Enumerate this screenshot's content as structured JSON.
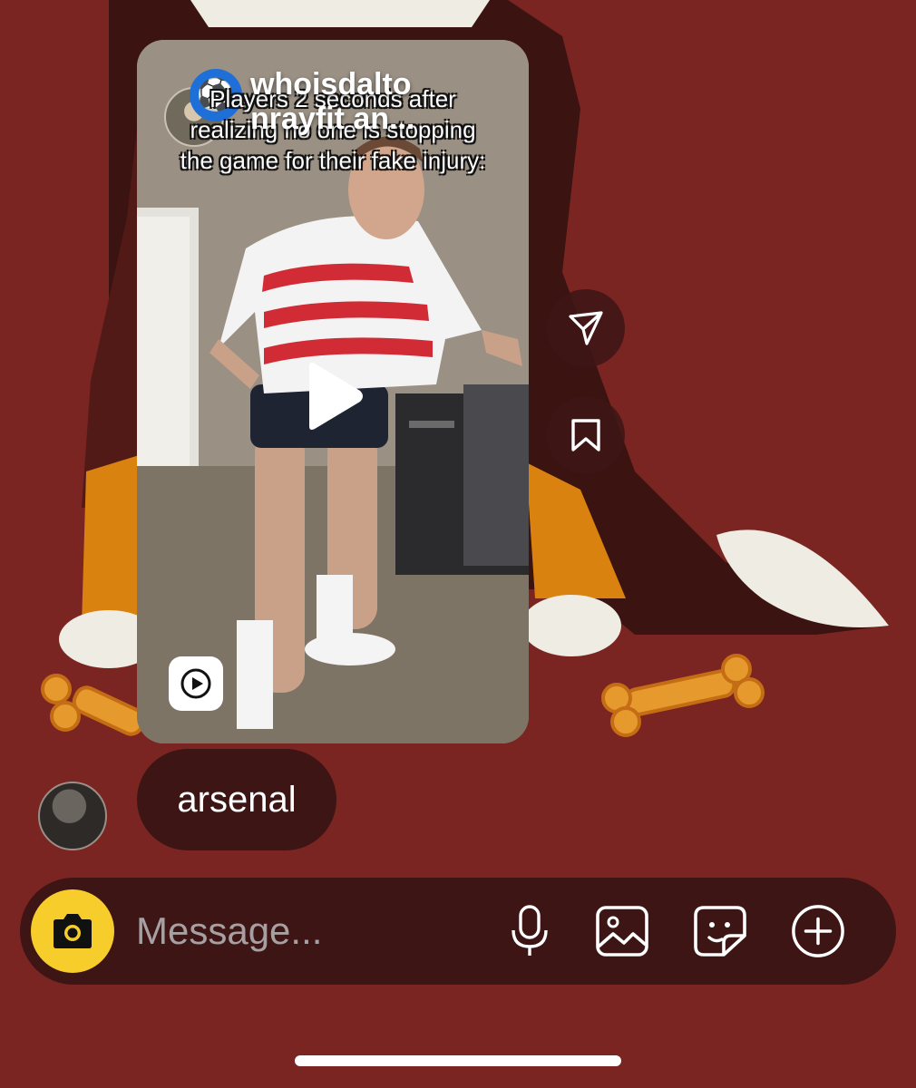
{
  "colors": {
    "background": "#7a2521",
    "bubble": "#3d1515",
    "camera_accent": "#f6cd2a",
    "placeholder": "#a7a0a3"
  },
  "reel": {
    "author_name": "whoisdalto nrayfit an...",
    "caption": "Players 2 seconds after realizing no one is stopping the game for their fake injury:",
    "badge_icon": "soccer-ball-icon",
    "play_icon": "play-icon",
    "type_icon": "reels-icon"
  },
  "side_actions": {
    "share_icon": "send-icon",
    "save_icon": "bookmark-icon"
  },
  "message": {
    "text": "arsenal"
  },
  "composer": {
    "placeholder": "Message...",
    "icons": [
      "camera-icon",
      "microphone-icon",
      "image-icon",
      "sticker-icon",
      "plus-circle-icon"
    ]
  }
}
